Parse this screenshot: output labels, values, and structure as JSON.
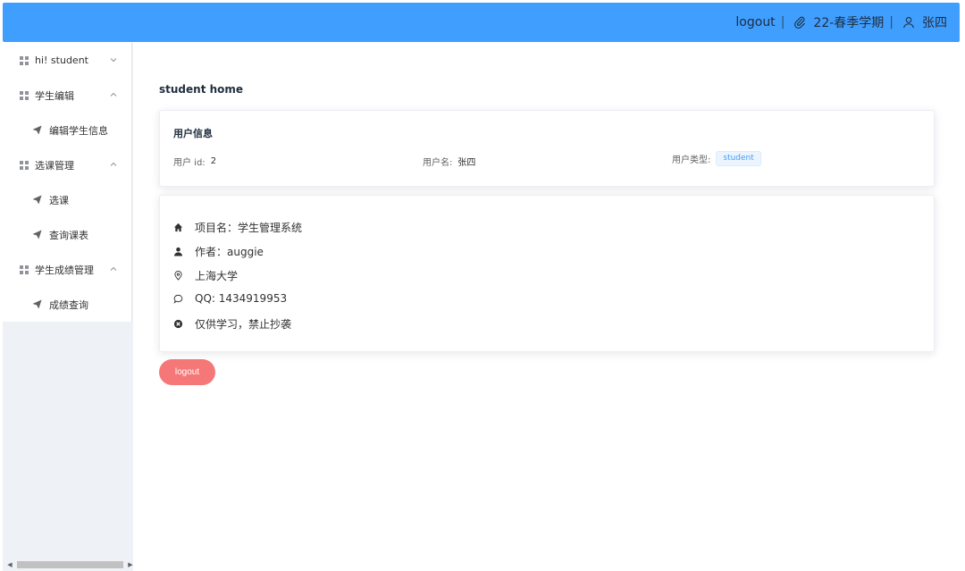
{
  "header": {
    "logout_label": "logout",
    "semester": "22-春季学期",
    "username": "张四",
    "separator": "|",
    "bg_color": "#409eff"
  },
  "sidebar": {
    "items": [
      {
        "label": "hi! student",
        "icon": "grid-icon",
        "expanded": false
      },
      {
        "label": "学生编辑",
        "icon": "grid-icon",
        "expanded": true,
        "children": [
          {
            "label": "编辑学生信息",
            "icon": "paper-plane-icon"
          }
        ]
      },
      {
        "label": "选课管理",
        "icon": "grid-icon",
        "expanded": true,
        "children": [
          {
            "label": "选课",
            "icon": "paper-plane-icon"
          },
          {
            "label": "查询课表",
            "icon": "paper-plane-icon"
          }
        ]
      },
      {
        "label": "学生成绩管理",
        "icon": "grid-icon",
        "expanded": true,
        "children": [
          {
            "label": "成绩查询",
            "icon": "paper-plane-icon"
          }
        ]
      }
    ]
  },
  "main": {
    "title": "student home",
    "user_card": {
      "title": "用户信息",
      "id_label": "用户 id:",
      "id_value": "2",
      "name_label": "用户名:",
      "name_value": "张四",
      "type_label": "用户类型:",
      "type_value": "student"
    },
    "about": {
      "project": "项目名：学生管理系统",
      "author": "作者：auggie",
      "location": "上海大学",
      "qq": "QQ: 1434919953",
      "notice": "仅供学习，禁止抄袭"
    },
    "logout_button": "logout",
    "logout_color": "#f56c6c"
  }
}
